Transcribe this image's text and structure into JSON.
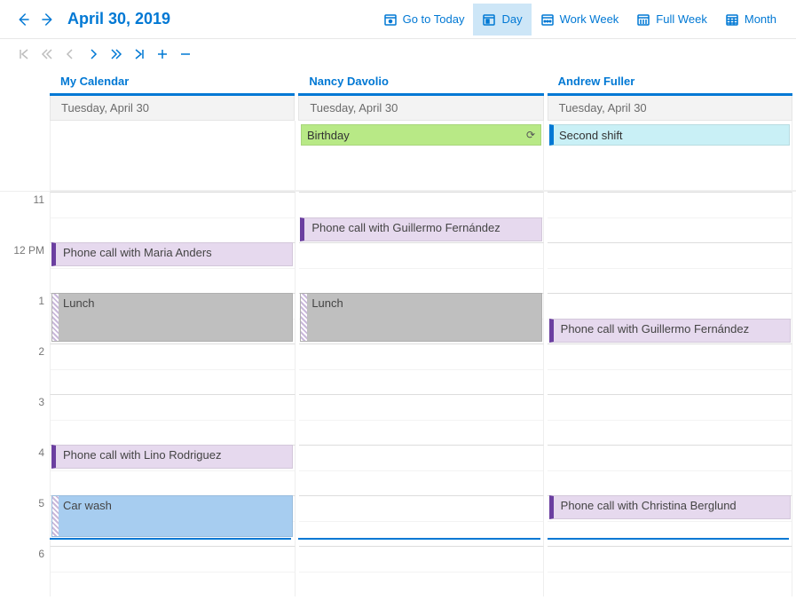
{
  "header": {
    "title": "April 30, 2019",
    "views": {
      "today": "Go to Today",
      "day": "Day",
      "workweek": "Work Week",
      "fullweek": "Full Week",
      "month": "Month"
    }
  },
  "calendars": [
    {
      "name": "My Calendar",
      "date": "Tuesday, April 30"
    },
    {
      "name": "Nancy Davolio",
      "date": "Tuesday, April 30"
    },
    {
      "name": "Andrew Fuller",
      "date": "Tuesday, April 30"
    }
  ],
  "allday": {
    "col1": {
      "birthday": "Birthday"
    },
    "col2": {
      "shift": "Second shift"
    }
  },
  "hours": [
    "11",
    "12 PM",
    "1",
    "2",
    "3",
    "4",
    "5",
    "6"
  ],
  "events": {
    "c0": {
      "maria": "Phone call with Maria Anders",
      "lunch": "Lunch",
      "lino": "Phone call with Lino Rodriguez",
      "carwash": "Car wash"
    },
    "c1": {
      "guillermo": "Phone call with Guillermo Fernández",
      "lunch": "Lunch"
    },
    "c2": {
      "guillermo": "Phone call with Guillermo Fernández",
      "christina": "Phone call with Christina Berglund"
    }
  },
  "colors": {
    "accent": "#0078d4",
    "purple": "#e6d9ee",
    "green": "#b8e986",
    "cyan": "#c9f0f6",
    "blue": "#a7cdf0",
    "gray": "#bfbfbf"
  }
}
